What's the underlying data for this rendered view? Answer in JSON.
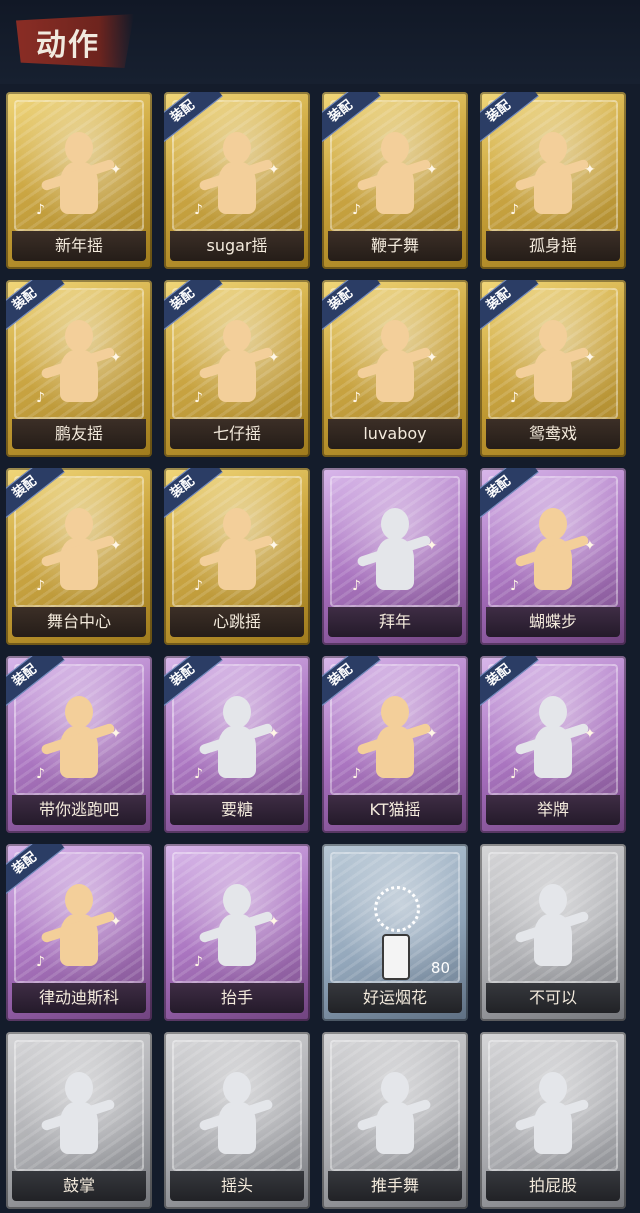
{
  "page": {
    "title": "动作"
  },
  "cards": [
    {
      "label": "新年摇",
      "equipped": false,
      "rarity": "gold"
    },
    {
      "label": "sugar摇",
      "equipped": true,
      "rarity": "gold"
    },
    {
      "label": "鞭子舞",
      "equipped": true,
      "rarity": "gold"
    },
    {
      "label": "孤身摇",
      "equipped": true,
      "rarity": "gold"
    },
    {
      "label": "鹏友摇",
      "equipped": true,
      "rarity": "gold"
    },
    {
      "label": "七仔摇",
      "equipped": true,
      "rarity": "gold"
    },
    {
      "label": "luvaboy",
      "equipped": true,
      "rarity": "gold"
    },
    {
      "label": "鸳鸯戏",
      "equipped": true,
      "rarity": "gold"
    },
    {
      "label": "舞台中心",
      "equipped": true,
      "rarity": "gold"
    },
    {
      "label": "心跳摇",
      "equipped": true,
      "rarity": "gold"
    },
    {
      "label": "拜年",
      "equipped": false,
      "rarity": "purple"
    },
    {
      "label": "蝴蝶步",
      "equipped": true,
      "rarity": "purple"
    },
    {
      "label": "带你逃跑吧",
      "equipped": true,
      "rarity": "purple"
    },
    {
      "label": "要糖",
      "equipped": true,
      "rarity": "purple"
    },
    {
      "label": "KT猫摇",
      "equipped": true,
      "rarity": "purple"
    },
    {
      "label": "举牌",
      "equipped": true,
      "rarity": "purple"
    },
    {
      "label": "律动迪斯科",
      "equipped": true,
      "rarity": "purple"
    },
    {
      "label": "抬手",
      "equipped": false,
      "rarity": "purple"
    },
    {
      "label": "好运烟花",
      "equipped": false,
      "rarity": "blue",
      "count": "80"
    },
    {
      "label": "不可以",
      "equipped": false,
      "rarity": "gray"
    },
    {
      "label": "鼓掌",
      "equipped": false,
      "rarity": "gray"
    },
    {
      "label": "摇头",
      "equipped": false,
      "rarity": "gray"
    },
    {
      "label": "推手舞",
      "equipped": false,
      "rarity": "gray"
    },
    {
      "label": "拍屁股",
      "equipped": false,
      "rarity": "gray"
    }
  ],
  "badge": {
    "equip_label": "装配"
  },
  "colors": {
    "gold": "#caa33a",
    "purple": "#a76fbe",
    "blue": "#8ea3b8",
    "gray": "#a9aaae",
    "badge": "#2b3d65"
  },
  "icons": {
    "figure": "dancer-silhouette-icon",
    "note": "music-note-icon",
    "sparkle": "sparkle-icon",
    "firework": "firework-icon"
  }
}
